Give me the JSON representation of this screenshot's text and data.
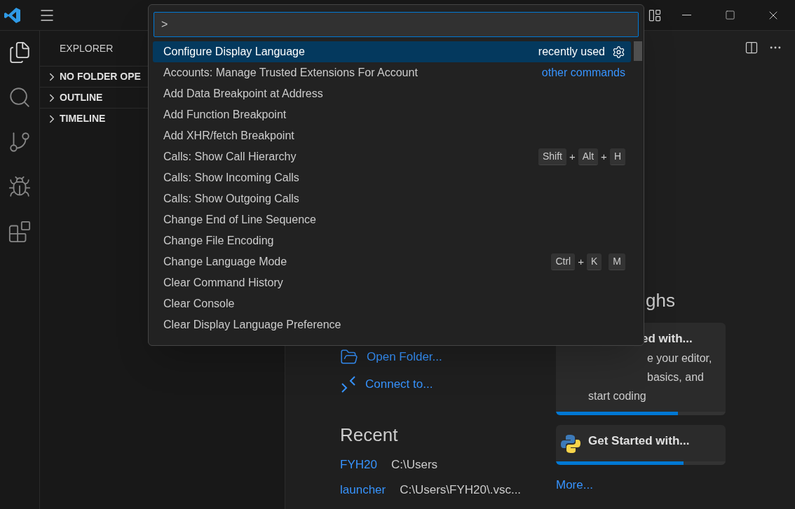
{
  "sidebar": {
    "title": "EXPLORER",
    "sections": [
      {
        "label": "NO FOLDER OPE",
        "expanded": false
      },
      {
        "label": "OUTLINE",
        "expanded": false
      },
      {
        "label": "TIMELINE",
        "expanded": false
      }
    ]
  },
  "editor": {
    "actions": [
      {
        "kind": "folder",
        "label": "Open Folder..."
      },
      {
        "kind": "remote",
        "label": "Connect to..."
      }
    ],
    "recent_heading": "Recent",
    "recent": [
      {
        "name": "FYH20",
        "path": "C:\\Users"
      },
      {
        "name": "launcher",
        "path": "C:\\Users\\FYH20\\.vsc..."
      }
    ],
    "walkthroughs_heading": "ghs",
    "walkthroughs": [
      {
        "kind": "generic",
        "title": "ed with...",
        "lines": [
          "e your editor,",
          "basics, and",
          "start coding"
        ],
        "level": 0.72
      },
      {
        "kind": "python",
        "title": "Get Started with...",
        "level": 0.75
      }
    ],
    "more": "More..."
  },
  "command_palette": {
    "value": ">",
    "items": [
      {
        "label": "Configure Display Language",
        "selected": true,
        "detail": {
          "kind": "recent",
          "text": "recently used"
        }
      },
      {
        "label": "Accounts: Manage Trusted Extensions For Account",
        "selected": false,
        "detail": {
          "kind": "link",
          "text": "other commands"
        }
      },
      {
        "label": "Add Data Breakpoint at Address",
        "selected": false
      },
      {
        "label": "Add Function Breakpoint",
        "selected": false
      },
      {
        "label": "Add XHR/fetch Breakpoint",
        "selected": false
      },
      {
        "label": "Calls: Show Call Hierarchy",
        "selected": false,
        "keys": [
          {
            "kind": "key",
            "text": "Shift"
          },
          {
            "kind": "plus",
            "text": "+"
          },
          {
            "kind": "key",
            "text": "Alt"
          },
          {
            "kind": "plus",
            "text": "+"
          },
          {
            "kind": "key",
            "text": "H"
          }
        ]
      },
      {
        "label": "Calls: Show Incoming Calls",
        "selected": false
      },
      {
        "label": "Calls: Show Outgoing Calls",
        "selected": false
      },
      {
        "label": "Change End of Line Sequence",
        "selected": false
      },
      {
        "label": "Change File Encoding",
        "selected": false
      },
      {
        "label": "Change Language Mode",
        "selected": false,
        "keys": [
          {
            "kind": "key",
            "text": "Ctrl"
          },
          {
            "kind": "plus",
            "text": "+"
          },
          {
            "kind": "key",
            "text": "K"
          },
          {
            "kind": "key",
            "text": "M"
          }
        ]
      },
      {
        "label": "Clear Command History",
        "selected": false
      },
      {
        "label": "Clear Console",
        "selected": false
      },
      {
        "label": "Clear Display Language Preference",
        "selected": false
      }
    ]
  }
}
